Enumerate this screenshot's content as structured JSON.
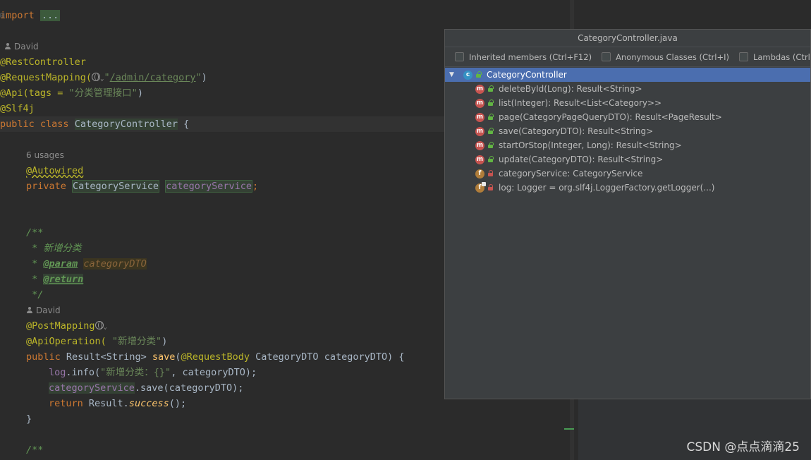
{
  "editor": {
    "lines": {
      "import_kw": "import",
      "import_fold": "...",
      "author1": "David",
      "rest_controller": "@RestController",
      "request_mapping": "@RequestMapping(",
      "request_mapping_url": "/admin/category",
      "api": "@Api(tags = ",
      "api_tags": "\"分类管理接口\"",
      "slf4j": "@Slf4j",
      "class_kw": "public class",
      "class_name": "CategoryController",
      "class_brace": " {",
      "usages": "6 usages",
      "autowired": "@Autowired",
      "private_kw": "private",
      "service_type": "CategoryService",
      "service_field": "categoryService",
      "doc_open": "/**",
      "doc_desc": " * 新增分类",
      "doc_param_tag": "@param",
      "doc_param_name": "categoryDTO",
      "doc_return_tag": "@return",
      "doc_close": " */",
      "author2": "David",
      "post_mapping": "@PostMapping",
      "api_operation": "@ApiOperation( ",
      "api_operation_str": "\"新增分类\"",
      "method_public": "public",
      "method_sig_type": " Result<String> ",
      "method_name": "save",
      "method_param_ann": "@RequestBody",
      "method_params": " CategoryDTO categoryDTO) {",
      "log_field": "log",
      "log_call": ".info(",
      "log_str": "\"新增分类：{}\"",
      "log_rest": ", categoryDTO);",
      "service_call_field": "categoryService",
      "service_call": ".save(categoryDTO);",
      "return_kw": "return",
      "return_expr": " Result.",
      "return_method": "success",
      "return_end": "();",
      "close_brace": "}",
      "doc_open2": "/**"
    }
  },
  "popup": {
    "title": "CategoryController.java",
    "filters": [
      {
        "label": "Inherited members (Ctrl+F12)",
        "checked": false
      },
      {
        "label": "Anonymous Classes (Ctrl+I)",
        "checked": false
      },
      {
        "label": "Lambdas (Ctrl+L)",
        "checked": false
      }
    ],
    "root": {
      "label": "CategoryController",
      "icon": "c"
    },
    "members": [
      {
        "label": "deleteById(Long): Result<String>",
        "icon": "m",
        "visibility": "public"
      },
      {
        "label": "list(Integer): Result<List<Category>>",
        "icon": "m",
        "visibility": "public"
      },
      {
        "label": "page(CategoryPageQueryDTO): Result<PageResult>",
        "icon": "m",
        "visibility": "public"
      },
      {
        "label": "save(CategoryDTO): Result<String>",
        "icon": "m",
        "visibility": "public"
      },
      {
        "label": "startOrStop(Integer, Long): Result<String>",
        "icon": "m",
        "visibility": "public"
      },
      {
        "label": "update(CategoryDTO): Result<String>",
        "icon": "m",
        "visibility": "public"
      },
      {
        "label": "categoryService: CategoryService",
        "icon": "f",
        "visibility": "private"
      },
      {
        "label": "log: Logger = org.slf4j.LoggerFactory.getLogger(...)",
        "icon": "f",
        "visibility": "private"
      }
    ]
  },
  "watermark": "CSDN @点点滴滴25"
}
